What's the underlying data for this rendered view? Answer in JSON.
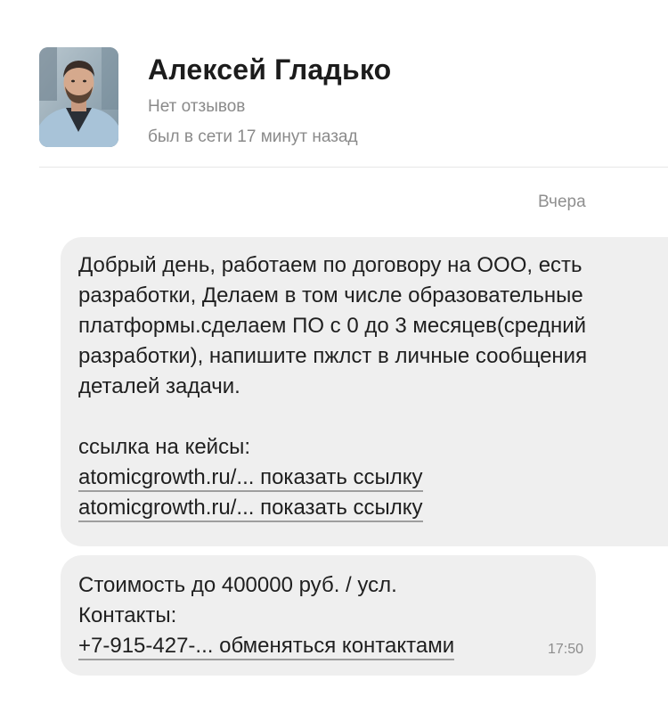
{
  "header": {
    "name": "Алексей Гладько",
    "reviews": "Нет отзывов",
    "last_seen": "был в сети 17 минут назад"
  },
  "chat": {
    "date_separator": "Вчера",
    "messages": [
      {
        "lines": [
          "Добрый день, работаем по договору на ООО, есть",
          "разработки, Делаем в том числе образовательные",
          "платформы.сделаем ПО с 0 до 3 месяцев(средний",
          "разработки), напишите пжлст в личные сообщения",
          "деталей задачи."
        ],
        "cases_label": "ссылка на кейсы:",
        "links": [
          "atomicgrowth.ru/... показать ссылку",
          "atomicgrowth.ru/... показать ссылку"
        ]
      },
      {
        "lines": [
          "Стоимость до 400000 руб. / усл.",
          "Контакты:"
        ],
        "contact_link": "+7-915-427-... обменяться контактами",
        "time": "17:50"
      }
    ]
  },
  "icons": {
    "avatar": "user-photo"
  }
}
